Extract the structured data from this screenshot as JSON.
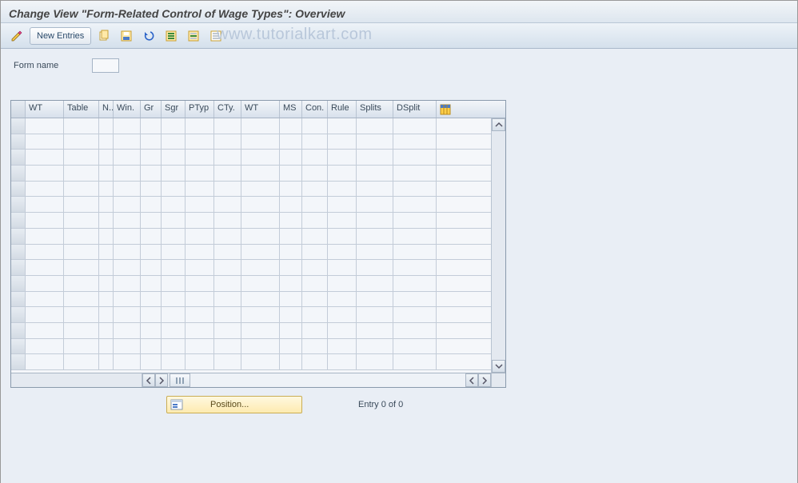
{
  "titlebar": {
    "title": "Change View \"Form-Related Control of Wage Types\": Overview"
  },
  "toolbar": {
    "new_entries_label": "New Entries",
    "icons": {
      "toggle": "toggle-change-icon",
      "copy": "copy-icon",
      "save": "save-icon",
      "undo": "undo-icon",
      "select_all": "select-all-icon",
      "select_block": "select-block-icon",
      "deselect": "deselect-icon"
    }
  },
  "watermark": "www.tutorialkart.com",
  "form": {
    "form_name_label": "Form name",
    "form_name_value": ""
  },
  "grid": {
    "columns": [
      "WT",
      "Table",
      "N..",
      "Win.",
      "Gr",
      "Sgr",
      "PTyp",
      "CTy.",
      "WT",
      "MS",
      "Con.",
      "Rule",
      "Splits",
      "DSplit"
    ],
    "rows": [],
    "empty_row_count": 16
  },
  "position": {
    "button_label": "Position...",
    "entry_text": "Entry 0 of 0"
  }
}
